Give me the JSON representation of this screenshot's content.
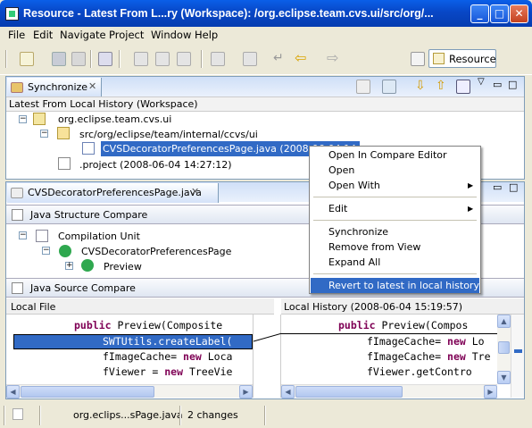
{
  "window": {
    "title": "Resource - Latest From L...ry (Workspace): /org.eclipse.team.cvs.ui/src/org/...",
    "min_glyph": "_",
    "max_glyph": "□",
    "close_glyph": "✕"
  },
  "menu": [
    "File",
    "Edit",
    "Navigate",
    "Project",
    "Window",
    "Help"
  ],
  "toolbar": {
    "perspective_label": "Resource"
  },
  "sync_view": {
    "tab_label": "Synchronize",
    "header": "Latest From Local History (Workspace)",
    "tree": [
      {
        "label": "org.eclipse.team.cvs.ui",
        "expander": "−"
      },
      {
        "label": "src/org/eclipse/team/internal/ccvs/ui",
        "expander": "−"
      },
      {
        "label": "CVSDecoratorPreferencesPage.java (2008-06-04 14:27:12)"
      },
      {
        "label": ".project (2008-06-04 14:27:12)"
      }
    ]
  },
  "editor": {
    "tab_label": "CVSDecoratorPreferencesPage.java",
    "structure_title": "Java Structure Compare",
    "structure_tree": [
      {
        "label": "Compilation Unit",
        "expander": "−"
      },
      {
        "label": "CVSDecoratorPreferencesPage",
        "expander": "−"
      },
      {
        "label": "Preview",
        "expander": "+"
      }
    ],
    "source_title": "Java Source Compare",
    "left_label": "Local File",
    "right_label": "Local History (2008-06-04 15:19:57)",
    "left_lines": [
      {
        "kw": "public ",
        "text": "Preview(Composite"
      },
      {
        "kw": "",
        "text": "SWTUtils.createLabel("
      },
      {
        "kw": "",
        "text": "fImageCache= ",
        "kw2": "new",
        "rest": " Loca"
      },
      {
        "kw": "",
        "text": "fViewer = ",
        "kw2": "new",
        "rest": " TreeVie"
      }
    ],
    "right_lines": [
      {
        "kw": "public ",
        "text": "Preview(Compos"
      },
      {
        "kw": "",
        "text": "fImageCache= ",
        "kw2": "new",
        "rest": " Lo"
      },
      {
        "kw": "",
        "text": "fImageCache= ",
        "kw2": "new",
        "rest": " Tre"
      },
      {
        "kw": "",
        "text": "fViewer.getContro"
      }
    ]
  },
  "context_menu": {
    "items": [
      {
        "label": "Open In Compare Editor"
      },
      {
        "label": "Open"
      },
      {
        "label": "Open With",
        "submenu": "▶"
      },
      {
        "label": "Edit",
        "submenu": "▶"
      },
      {
        "label": "Synchronize"
      },
      {
        "label": "Remove from View"
      },
      {
        "label": "Expand All"
      },
      {
        "label": "Revert to latest in local history"
      }
    ]
  },
  "status": {
    "file": "org.eclips...sPage.java",
    "changes": "2 changes"
  },
  "colors": {
    "selection": "#316ac5",
    "titlebar": "#0a5fe8",
    "keyword": "#7f0055"
  }
}
